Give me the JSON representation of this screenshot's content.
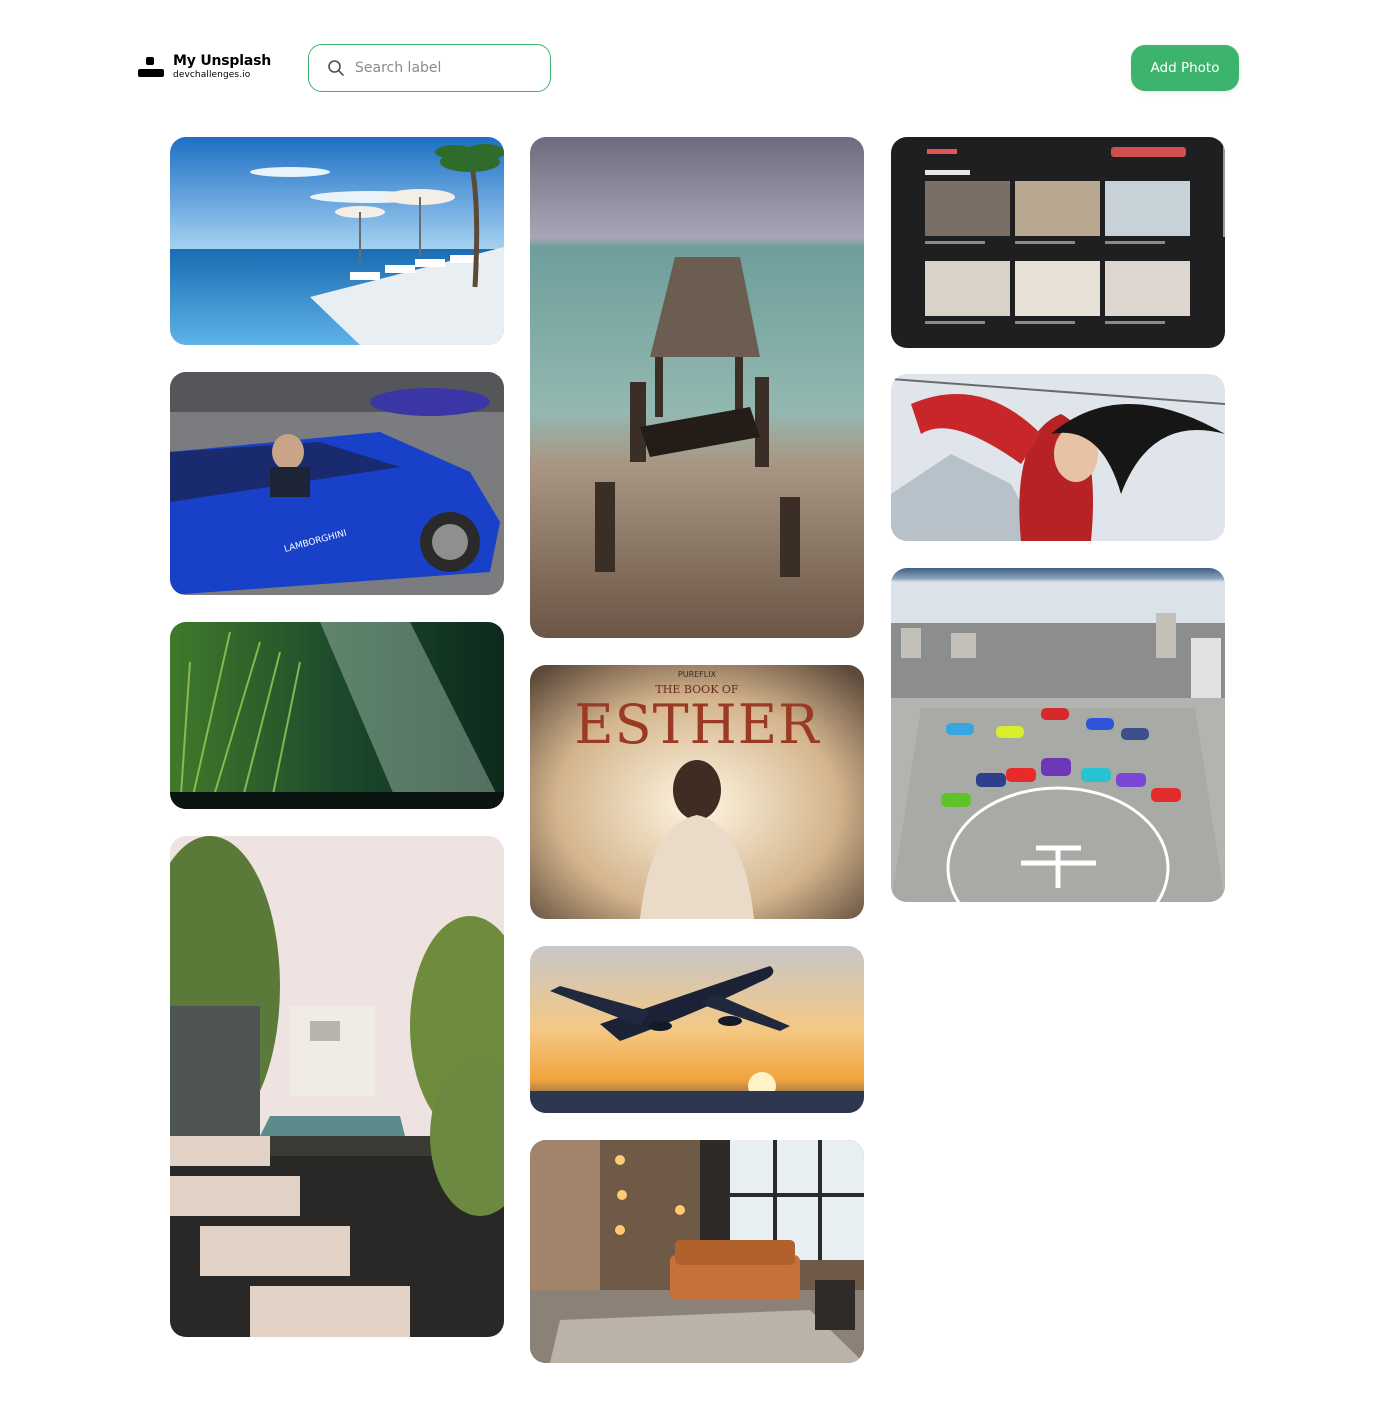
{
  "brand": {
    "title": "My Unsplash",
    "subtitle": "devchallenges.io"
  },
  "search": {
    "placeholder": "Search label",
    "value": ""
  },
  "add_photo_label": "Add Photo",
  "colors": {
    "accent": "#3db46d",
    "background": "#ffffff"
  },
  "icons": {
    "search": "search-icon",
    "logo": "user-icon"
  },
  "gallery": {
    "columns": 3,
    "photos": [
      {
        "subject": "infinity pool with umbrellas",
        "column": 1
      },
      {
        "subject": "blue lamborghini convertible",
        "column": 1
      },
      {
        "subject": "rain in forest",
        "column": 1
      },
      {
        "subject": "tropical house with pool",
        "column": 1
      },
      {
        "subject": "wooden pier at sea",
        "column": 2
      },
      {
        "subject": "the book of esther poster",
        "column": 2
      },
      {
        "subject": "airplane at sunset",
        "column": 2
      },
      {
        "subject": "loft with leather sofa",
        "column": 2
      },
      {
        "subject": "stays in finland web app screenshot",
        "column": 3
      },
      {
        "subject": "mulan warrior in red",
        "column": 3
      },
      {
        "subject": "supercars on rooftop helipad",
        "column": 3
      }
    ]
  }
}
